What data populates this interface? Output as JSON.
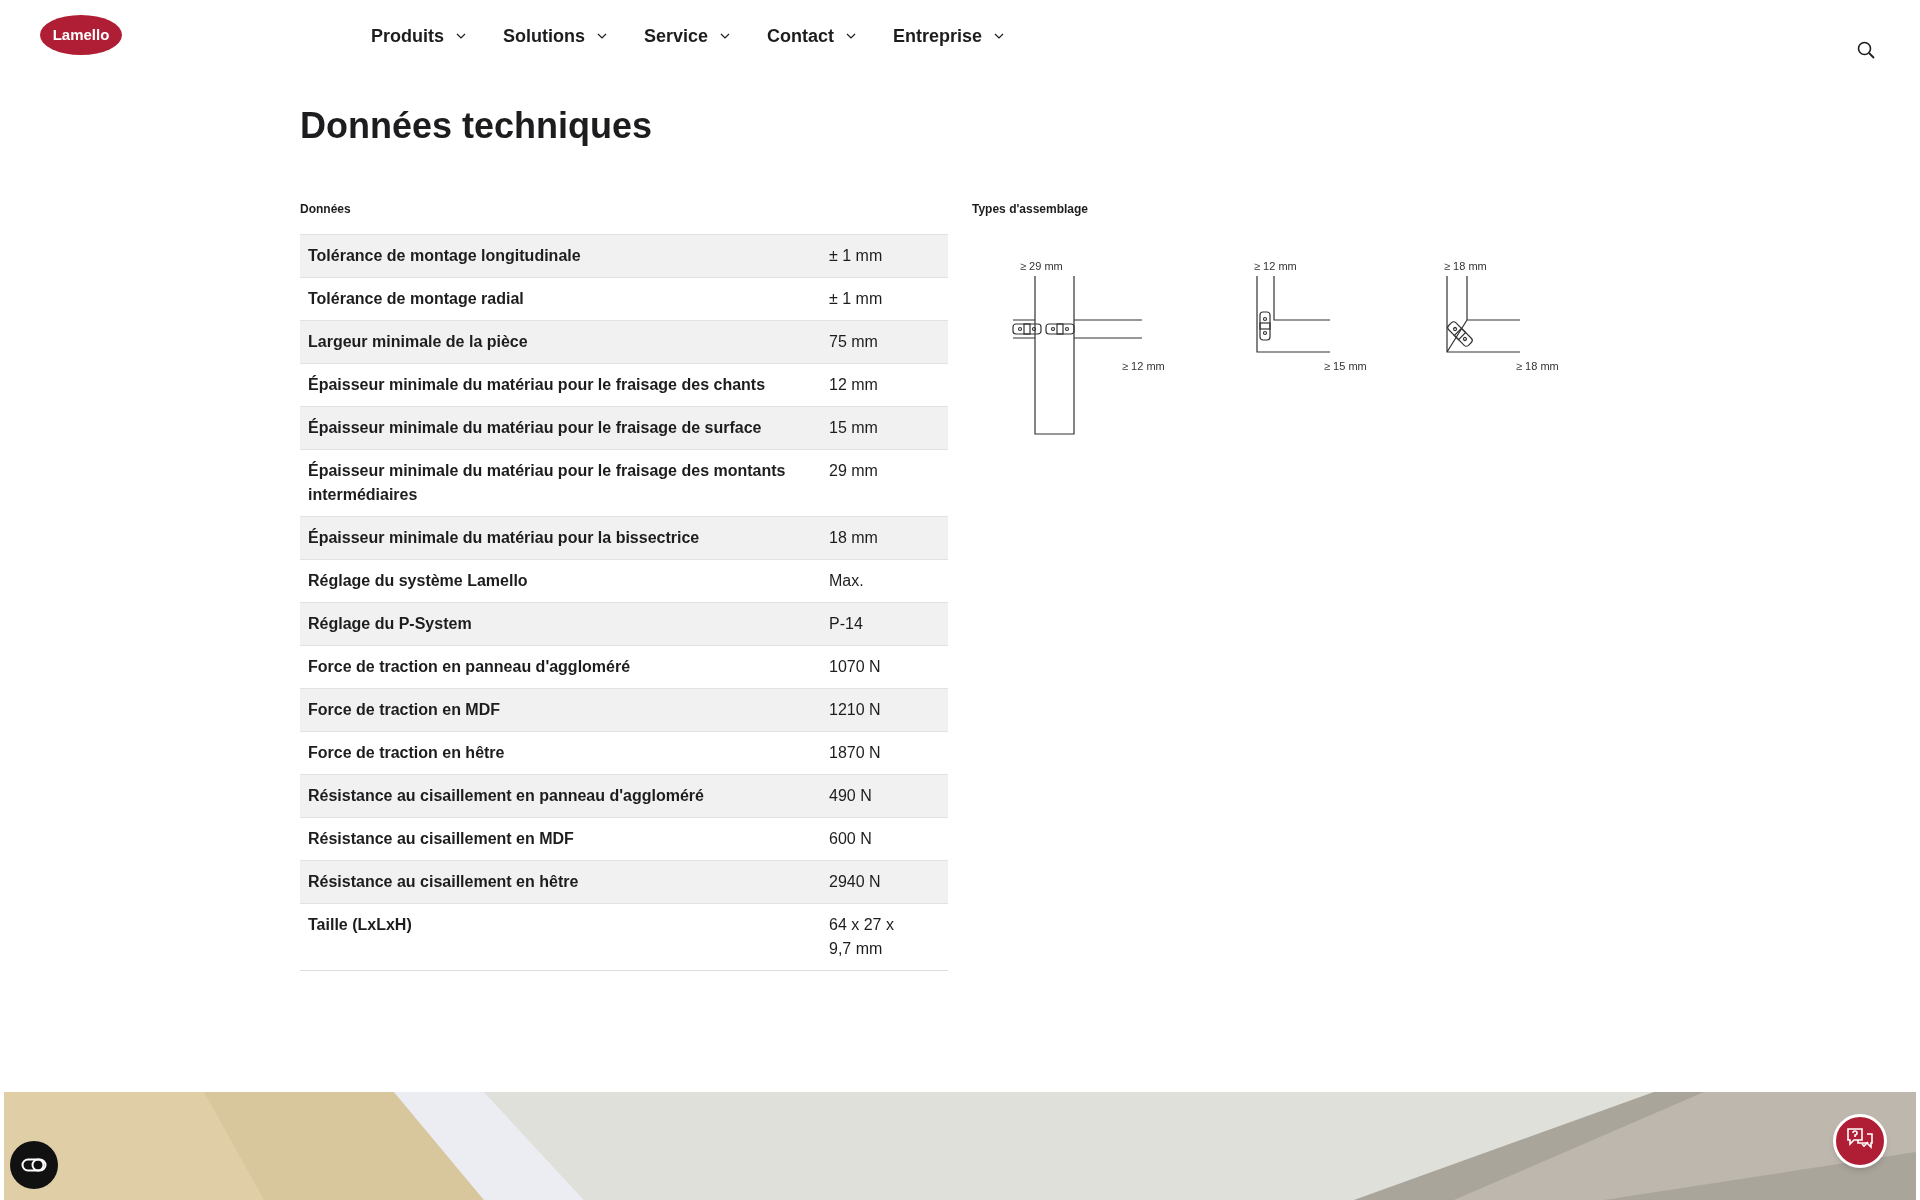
{
  "header": {
    "logo": "Lamello",
    "nav": [
      "Produits",
      "Solutions",
      "Service",
      "Contact",
      "Entreprise"
    ]
  },
  "title": "Données techniques",
  "data_section": {
    "heading": "Données",
    "rows": [
      {
        "label": "Tolérance de montage longitudinale",
        "value": "± 1 mm"
      },
      {
        "label": "Tolérance de montage radial",
        "value": "± 1 mm"
      },
      {
        "label": "Largeur minimale de la pièce",
        "value": "75 mm"
      },
      {
        "label": "Épaisseur minimale du matériau pour le fraisage des chants",
        "value": "12 mm"
      },
      {
        "label": "Épaisseur minimale du matériau pour le fraisage de surface",
        "value": "15 mm"
      },
      {
        "label": "Épaisseur minimale du matériau pour le fraisage des montants intermédiaires",
        "value": "29 mm"
      },
      {
        "label": "Épaisseur minimale du matériau pour la bissectrice",
        "value": "18 mm"
      },
      {
        "label": "Réglage du système Lamello",
        "value": "Max."
      },
      {
        "label": "Réglage du P-System",
        "value": "P-14"
      },
      {
        "label": "Force de traction en panneau d'aggloméré",
        "value": "1070 N"
      },
      {
        "label": "Force de traction en MDF",
        "value": "1210 N"
      },
      {
        "label": "Force de traction en hêtre",
        "value": "1870 N"
      },
      {
        "label": "Résistance au cisaillement en panneau d'aggloméré",
        "value": "490 N"
      },
      {
        "label": "Résistance au cisaillement en MDF",
        "value": "600 N"
      },
      {
        "label": "Résistance au cisaillement en hêtre",
        "value": "2940 N"
      },
      {
        "label": "Taille (LxLxH)",
        "value": "64 x 27 x 9,7 mm"
      }
    ]
  },
  "joints_section": {
    "heading": "Types d'assemblage",
    "diagrams": [
      {
        "kind": "t_joint",
        "top_label": "≥ 29 mm",
        "bottom_label": "≥ 12 mm"
      },
      {
        "kind": "corner",
        "top_label": "≥ 12 mm",
        "bottom_label": "≥ 15 mm"
      },
      {
        "kind": "miter",
        "top_label": "≥ 18 mm",
        "bottom_label": "≥ 18 mm"
      }
    ]
  }
}
